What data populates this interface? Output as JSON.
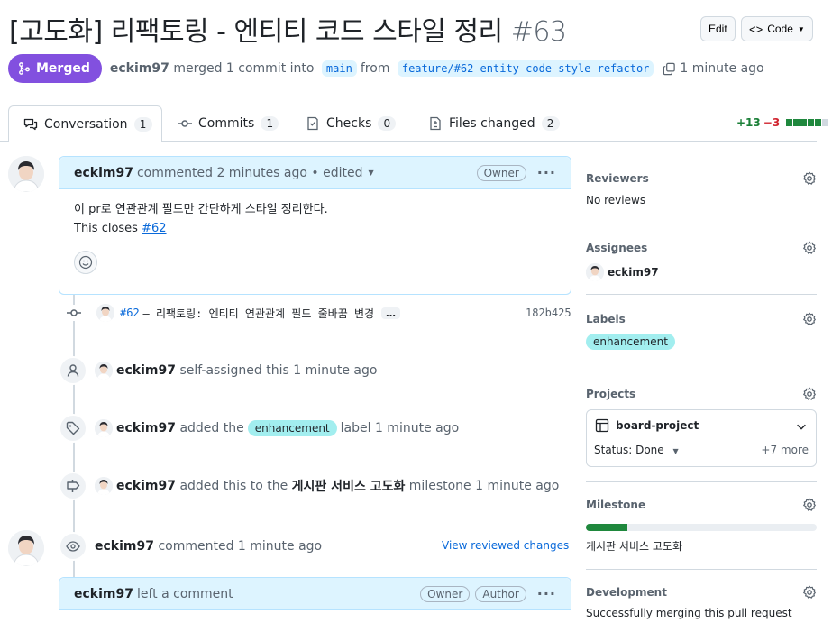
{
  "header": {
    "title": "[고도화] 리팩토링 - 엔티티 코드 스타일 정리",
    "number": "#63",
    "edit_label": "Edit",
    "code_label": "Code"
  },
  "state": {
    "badge": "Merged",
    "user": "eckim97",
    "text_merged": "merged 1 commit into",
    "base_branch": "main",
    "text_from": "from",
    "head_branch": "feature/#62-entity-code-style-refactor",
    "time": "1 minute ago",
    "badge_color": "#8250df"
  },
  "tabs": [
    {
      "label": "Conversation",
      "count": "1"
    },
    {
      "label": "Commits",
      "count": "1"
    },
    {
      "label": "Checks",
      "count": "0"
    },
    {
      "label": "Files changed",
      "count": "2"
    }
  ],
  "diffstat": {
    "additions": "+13",
    "deletions": "−3"
  },
  "comment1": {
    "author": "eckim97",
    "meta": "commented 2 minutes ago • edited",
    "role": "Owner",
    "body_line1": "이 pr로 연관관계 필드만 간단하게 스타일 정리한다.",
    "body_line2_prefix": "This closes",
    "body_line2_link": "#62"
  },
  "commit": {
    "ref": "#62",
    "message": "– 리팩토링: 엔티티 연관관계 필드 줄바꿈 변경",
    "more": "…",
    "sha": "182b425"
  },
  "events": {
    "assigned_user": "eckim97",
    "assigned_text": "self-assigned this 1 minute ago",
    "label_user": "eckim97",
    "label_text_pre": "added the",
    "label_name": "enhancement",
    "label_text_post": "label 1 minute ago",
    "milestone_user": "eckim97",
    "milestone_text_pre": "added this to the",
    "milestone_name": "게시판 서비스 고도화",
    "milestone_text_post": "milestone 1 minute ago",
    "review_user": "eckim97",
    "review_text": "commented 1 minute ago",
    "review_link": "View reviewed changes"
  },
  "comment2": {
    "author": "eckim97",
    "meta": "left a comment",
    "role1": "Owner",
    "role2": "Author"
  },
  "sidebar": {
    "reviewers_title": "Reviewers",
    "reviewers_value": "No reviews",
    "assignees_title": "Assignees",
    "assignee": "eckim97",
    "labels_title": "Labels",
    "label": "enhancement",
    "projects_title": "Projects",
    "project_name": "board-project",
    "project_status": "Status: Done",
    "project_more": "+7 more",
    "milestone_title": "Milestone",
    "milestone_name": "게시판 서비스 고도화",
    "milestone_progress": 0.18,
    "development_title": "Development",
    "development_text": "Successfully merging this pull request may"
  }
}
